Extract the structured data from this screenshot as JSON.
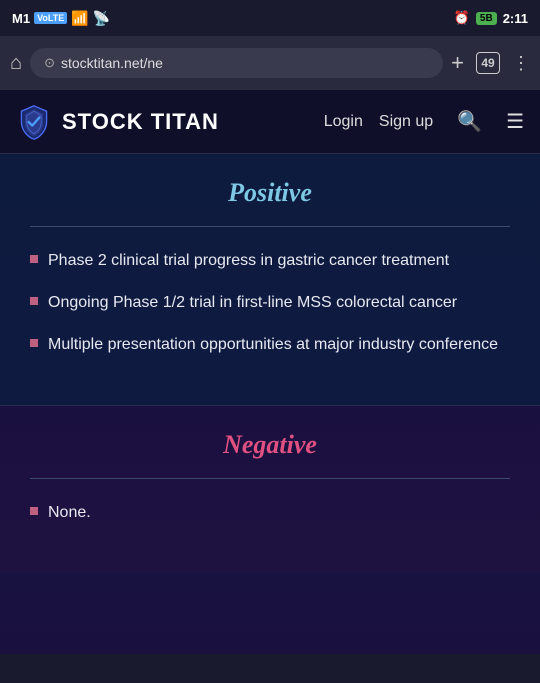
{
  "statusBar": {
    "carrier": "M1",
    "carrierType": "VoLTE",
    "signal": "▂▄▆",
    "wifi": "WiFi",
    "alarm": "⏰",
    "battery": "5B",
    "time": "2:11"
  },
  "browserBar": {
    "addressText": "stocktitan.net/ne",
    "tabCount": "49",
    "homeIcon": "⌂",
    "plusIcon": "+",
    "menuIcon": "⋮"
  },
  "navBar": {
    "logoText": "STOCK TITAN",
    "loginLabel": "Login",
    "signupLabel": "Sign up"
  },
  "positiveSection": {
    "title": "Positive",
    "items": [
      "Phase 2 clinical trial progress in gastric cancer treatment",
      "Ongoing Phase 1/2 trial in first-line MSS colorectal cancer",
      "Multiple presentation opportunities at major industry conference"
    ]
  },
  "negativeSection": {
    "title": "Negative",
    "items": [
      "None."
    ]
  }
}
